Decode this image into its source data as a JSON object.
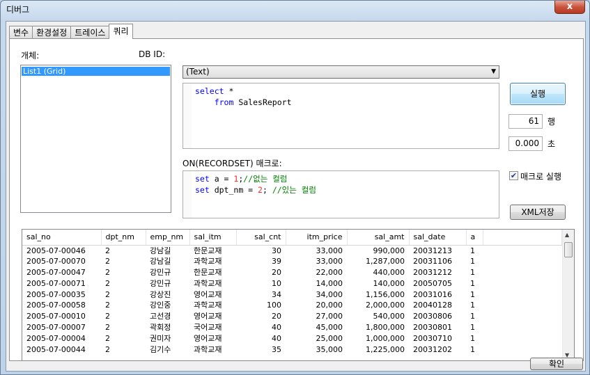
{
  "window": {
    "title": "디버그",
    "close": "x"
  },
  "tabs": [
    "변수",
    "환경설정",
    "트레이스",
    "쿼리"
  ],
  "object_label": "개체:",
  "dbid_label": "DB ID:",
  "dbid_value": "(Text)",
  "objects": [
    "List1 (Grid)"
  ],
  "sql": {
    "l1_kw": "select",
    "l1_rest": " *",
    "l2_kw": "from",
    "l2_rest": " SalesReport"
  },
  "macro_label": "ON(RECORDSET) 매크로:",
  "macro": {
    "l1_kw": "set",
    "l1_a": " a = ",
    "l1_num": "1",
    "l1_semi": ";",
    "l1_cm": "//없는 컬럼",
    "l2_kw": "set",
    "l2_a": " dpt_nm = ",
    "l2_num": "2",
    "l2_semi": "; ",
    "l2_cm": "//있는 컬럼"
  },
  "run_button": "실행",
  "rows_value": "61",
  "rows_unit": "행",
  "secs_value": "0.000",
  "secs_unit": "초",
  "macro_run_label": "매크로 실행",
  "macro_run_checked": true,
  "xml_button": "XML저장",
  "ok_button": "확인",
  "grid": {
    "columns": [
      "sal_no",
      "dpt_nm",
      "emp_nm",
      "sal_itm",
      "sal_cnt",
      "itm_price",
      "sal_amt",
      "sal_date",
      "a"
    ],
    "rows": [
      [
        "2005-07-00046",
        "2",
        "강남길",
        "한문교재",
        "30",
        "33,000",
        "990,000",
        "20031213",
        "1"
      ],
      [
        "2005-07-00070",
        "2",
        "강남길",
        "과학교재",
        "39",
        "33,000",
        "1,287,000",
        "20031106",
        "1"
      ],
      [
        "2005-07-00047",
        "2",
        "강민규",
        "한문교재",
        "20",
        "22,000",
        "440,000",
        "20031212",
        "1"
      ],
      [
        "2005-07-00071",
        "2",
        "강민규",
        "과학교재",
        "10",
        "14,000",
        "140,000",
        "20050705",
        "1"
      ],
      [
        "2005-07-00035",
        "2",
        "강상진",
        "영어교재",
        "34",
        "34,000",
        "1,156,000",
        "20031016",
        "1"
      ],
      [
        "2005-07-00058",
        "2",
        "강인중",
        "과학교재",
        "100",
        "20,000",
        "2,000,000",
        "20040128",
        "1"
      ],
      [
        "2005-07-00010",
        "2",
        "고선경",
        "영어교재",
        "20",
        "27,000",
        "540,000",
        "20030806",
        "1"
      ],
      [
        "2005-07-00007",
        "2",
        "곽회정",
        "국어교재",
        "40",
        "45,000",
        "1,800,000",
        "20030801",
        "1"
      ],
      [
        "2005-07-00004",
        "2",
        "권미자",
        "영어교재",
        "40",
        "25,000",
        "1,000,000",
        "20030710",
        "1"
      ],
      [
        "2005-07-00044",
        "2",
        "김기수",
        "과학교재",
        "35",
        "35,000",
        "1,225,000",
        "20031202",
        "1"
      ]
    ]
  }
}
